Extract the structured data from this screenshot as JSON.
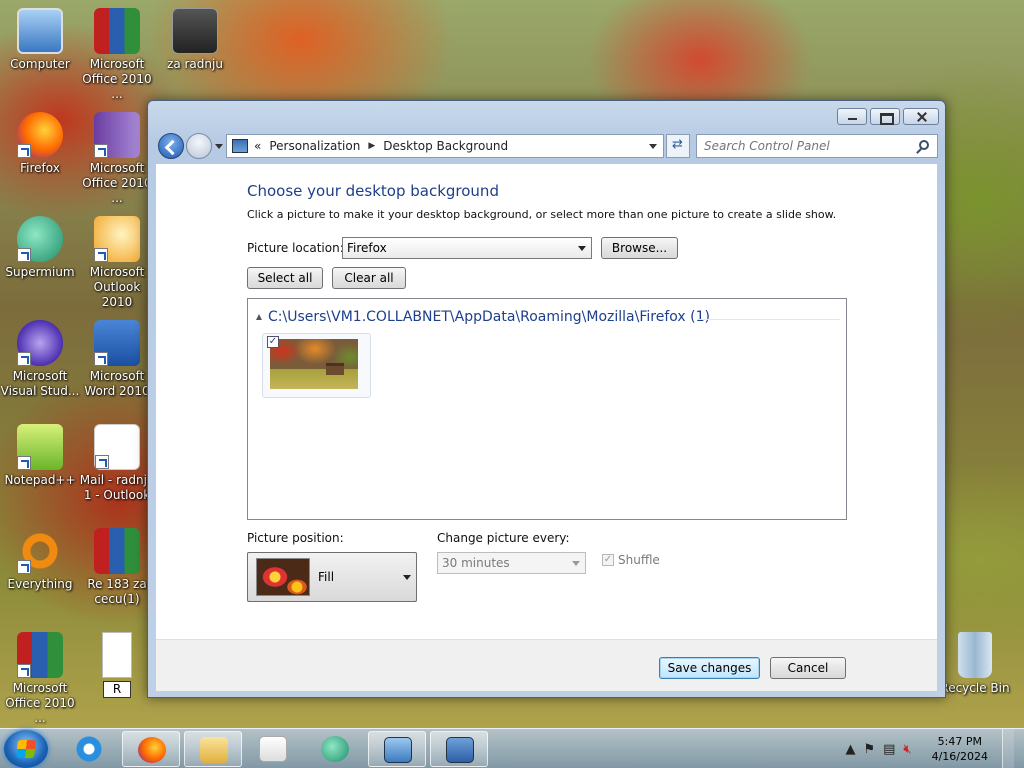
{
  "desktop_icons": [
    {
      "label": "Computer",
      "icon": "computer-icon"
    },
    {
      "label": "Microsoft Office 2010 ...",
      "icon": "winrar-icon"
    },
    {
      "label": "za radnju",
      "icon": "folder-icon"
    },
    {
      "label": "Firefox",
      "icon": "firefox-icon"
    },
    {
      "label": "Microsoft Office 2010 ...",
      "icon": "winrar-icon"
    },
    {
      "label": "Supermium",
      "icon": "supermium-icon"
    },
    {
      "label": "Microsoft Outlook 2010",
      "icon": "outlook-icon"
    },
    {
      "label": "Microsoft Visual Stud...",
      "icon": "visual-studio-icon"
    },
    {
      "label": "Microsoft Word 2010",
      "icon": "word-icon"
    },
    {
      "label": "Notepad++",
      "icon": "notepadpp-icon"
    },
    {
      "label": "Mail - radnja 1 - Outlook",
      "icon": "outlook-mail-icon"
    },
    {
      "label": "Everything",
      "icon": "everything-icon"
    },
    {
      "label": "Re 183 za cecu(1)",
      "icon": "winrar-icon"
    },
    {
      "label": "Microsoft Office 2010 ...",
      "icon": "winrar-icon"
    },
    {
      "label": "R",
      "icon": "document-icon"
    },
    {
      "label": "Recycle Bin",
      "icon": "recycle-bin-icon"
    }
  ],
  "window": {
    "address": {
      "root_sep": "«",
      "crumb1": "Personalization",
      "crumb_sep": "▶",
      "crumb2": "Desktop Background"
    },
    "search_placeholder": "Search Control Panel",
    "heading": "Choose your desktop background",
    "description": "Click a picture to make it your desktop background, or select more than one picture to create a slide show.",
    "picture_location_label": "Picture location:",
    "picture_location_value": "Firefox",
    "browse_label": "Browse...",
    "select_all_label": "Select all",
    "clear_all_label": "Clear all",
    "group_path": "C:\\Users\\VM1.COLLABNET\\AppData\\Roaming\\Mozilla\\Firefox (1)",
    "thumbnail_checked": true,
    "picture_position_label": "Picture position:",
    "picture_position_value": "Fill",
    "change_picture_label": "Change picture every:",
    "change_picture_value": "30 minutes",
    "shuffle_label": "Shuffle",
    "shuffle_checked": true,
    "save_label": "Save changes",
    "cancel_label": "Cancel"
  },
  "taskbar": {
    "items": [
      "internet-explorer-icon",
      "firefox-icon",
      "file-explorer-icon",
      "media-player-icon",
      "supermium-icon",
      "personalization-icon",
      "control-panel-icon"
    ],
    "time": "5:47 PM",
    "date": "4/16/2024"
  },
  "colors": {
    "heading": "#1e3f8c",
    "primary_button": "#bee6fd"
  }
}
